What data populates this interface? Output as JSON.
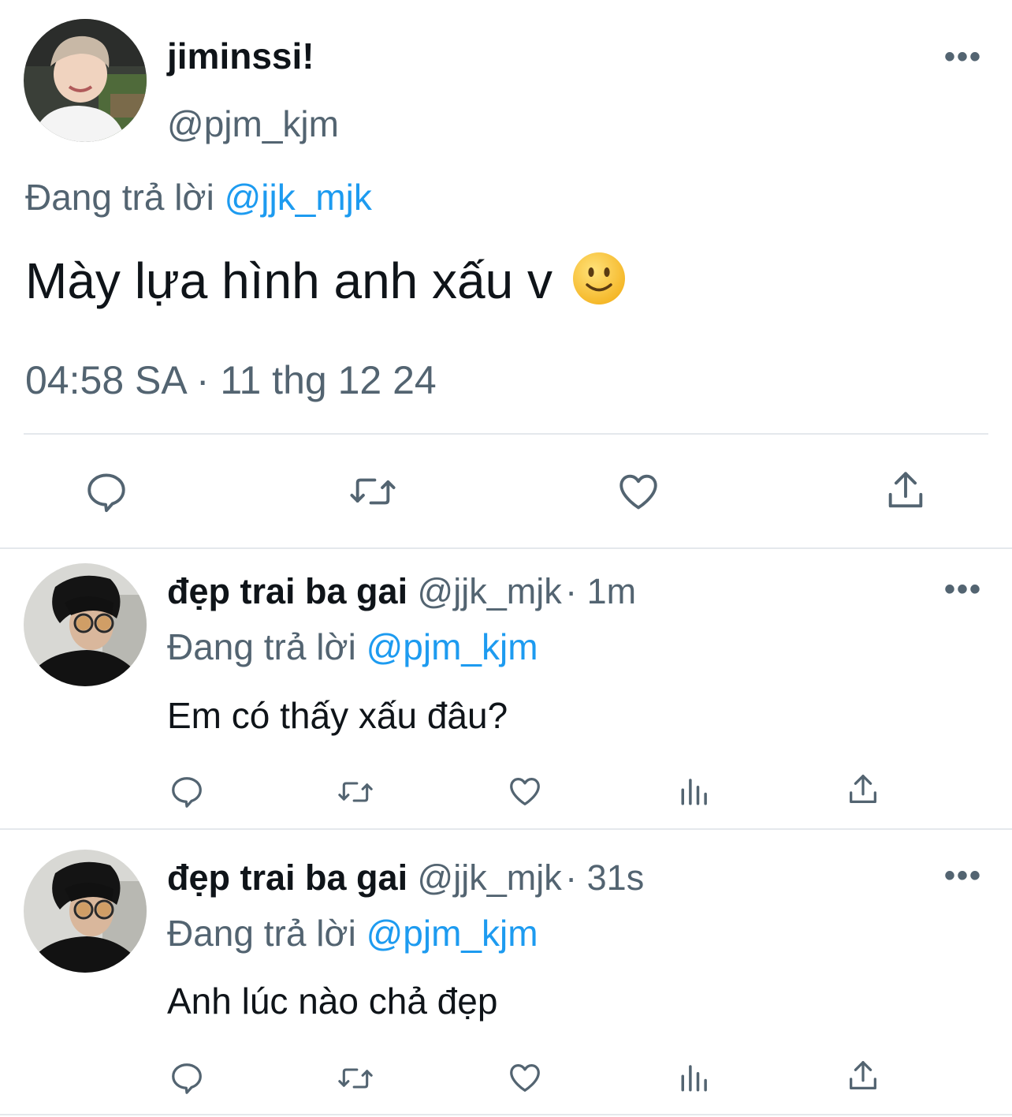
{
  "main_tweet": {
    "display_name": "jiminssi!",
    "handle": "@pjm_kjm",
    "replying_prefix": "Đang trả lời",
    "replying_to": "@jjk_mjk",
    "text": "Mày lựa hình anh xấu v",
    "emoji": "slightly-smiling-face",
    "timestamp": "04:58 SA · 11 thg 12 24",
    "actions": [
      "reply-icon",
      "retweet-icon",
      "like-icon",
      "share-icon"
    ]
  },
  "replies": [
    {
      "display_name": "đẹp trai ba gai",
      "handle": "@jjk_mjk",
      "time": "· 1m",
      "replying_prefix": "Đang trả lời",
      "replying_to": "@pjm_kjm",
      "text": "Em có thấy xấu đâu?",
      "actions": [
        "reply-icon",
        "retweet-icon",
        "like-icon",
        "views-icon",
        "share-icon"
      ]
    },
    {
      "display_name": "đẹp trai ba gai",
      "handle": "@jjk_mjk",
      "time": "· 31s",
      "replying_prefix": "Đang trả lời",
      "replying_to": "@pjm_kjm",
      "text": "Anh lúc nào chả đẹp",
      "actions": [
        "reply-icon",
        "retweet-icon",
        "like-icon",
        "views-icon",
        "share-icon"
      ]
    }
  ],
  "more_label": "•••",
  "colors": {
    "text": "#0f1419",
    "secondary": "#536471",
    "accent": "#1d9bf0",
    "divider": "#e4e8ec"
  }
}
